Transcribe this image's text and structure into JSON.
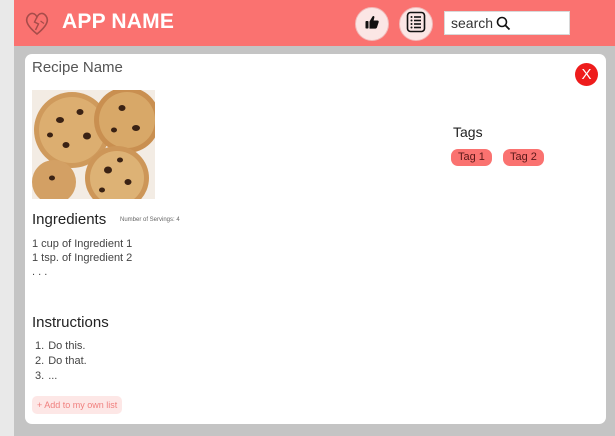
{
  "header": {
    "app_name": "APP NAME",
    "icons": {
      "logo": "broken-heart-logo",
      "like": "thumbs-up-icon",
      "list": "list-icon",
      "search": "search-icon"
    }
  },
  "search": {
    "label": "search"
  },
  "recipe": {
    "name": "Recipe Name",
    "close_label": "X",
    "image_alt": "chocolate chip cookies",
    "ingredients_title": "Ingredients",
    "servings_label": "Number of Servings: 4",
    "ingredients": [
      "1 cup of Ingredient 1",
      "1 tsp. of Ingredient 2",
      ". . ."
    ],
    "instructions_title": "Instructions",
    "instructions": [
      {
        "num": "1.",
        "text": "Do this."
      },
      {
        "num": "2.",
        "text": "Do that."
      },
      {
        "num": "3.",
        "text": "..."
      }
    ],
    "add_button": "+ Add to my own list"
  },
  "tags": {
    "title": "Tags",
    "items": [
      "Tag 1",
      "Tag 2"
    ]
  },
  "colors": {
    "accent": "#fa7270",
    "close_red": "#ee1c1c",
    "card_bg": "#ffffff",
    "frame_bg": "#c4c4c4"
  }
}
